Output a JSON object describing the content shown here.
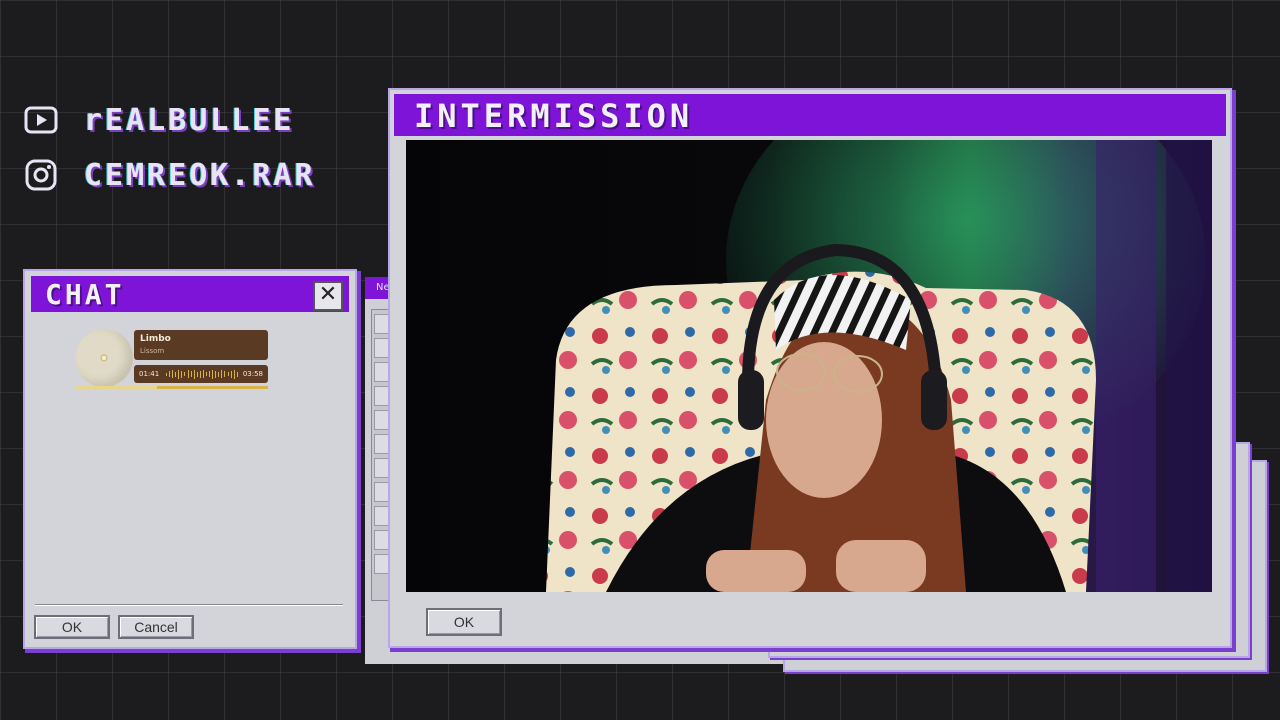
{
  "socials": [
    {
      "icon": "play-icon",
      "handle": "rEALBULLEE"
    },
    {
      "icon": "instagram-icon",
      "handle": "CEMREOK.RAR"
    }
  ],
  "chat_window": {
    "title": "CHAT",
    "close_label": "✕",
    "now_playing": {
      "track": "Limbo",
      "artist": "Lissom",
      "current_time": "01:41",
      "total_time": "03:58",
      "progress": 0.42
    },
    "ok_label": "OK",
    "cancel_label": "Cancel"
  },
  "tool_window": {
    "title_fragment": "Ne"
  },
  "main_window": {
    "title": "INTERMISSION",
    "ok_label": "OK"
  },
  "colors": {
    "titlebar": "#7f14d9",
    "window_bg": "#d3d3da",
    "accent_outline": "#7b3fd0"
  }
}
